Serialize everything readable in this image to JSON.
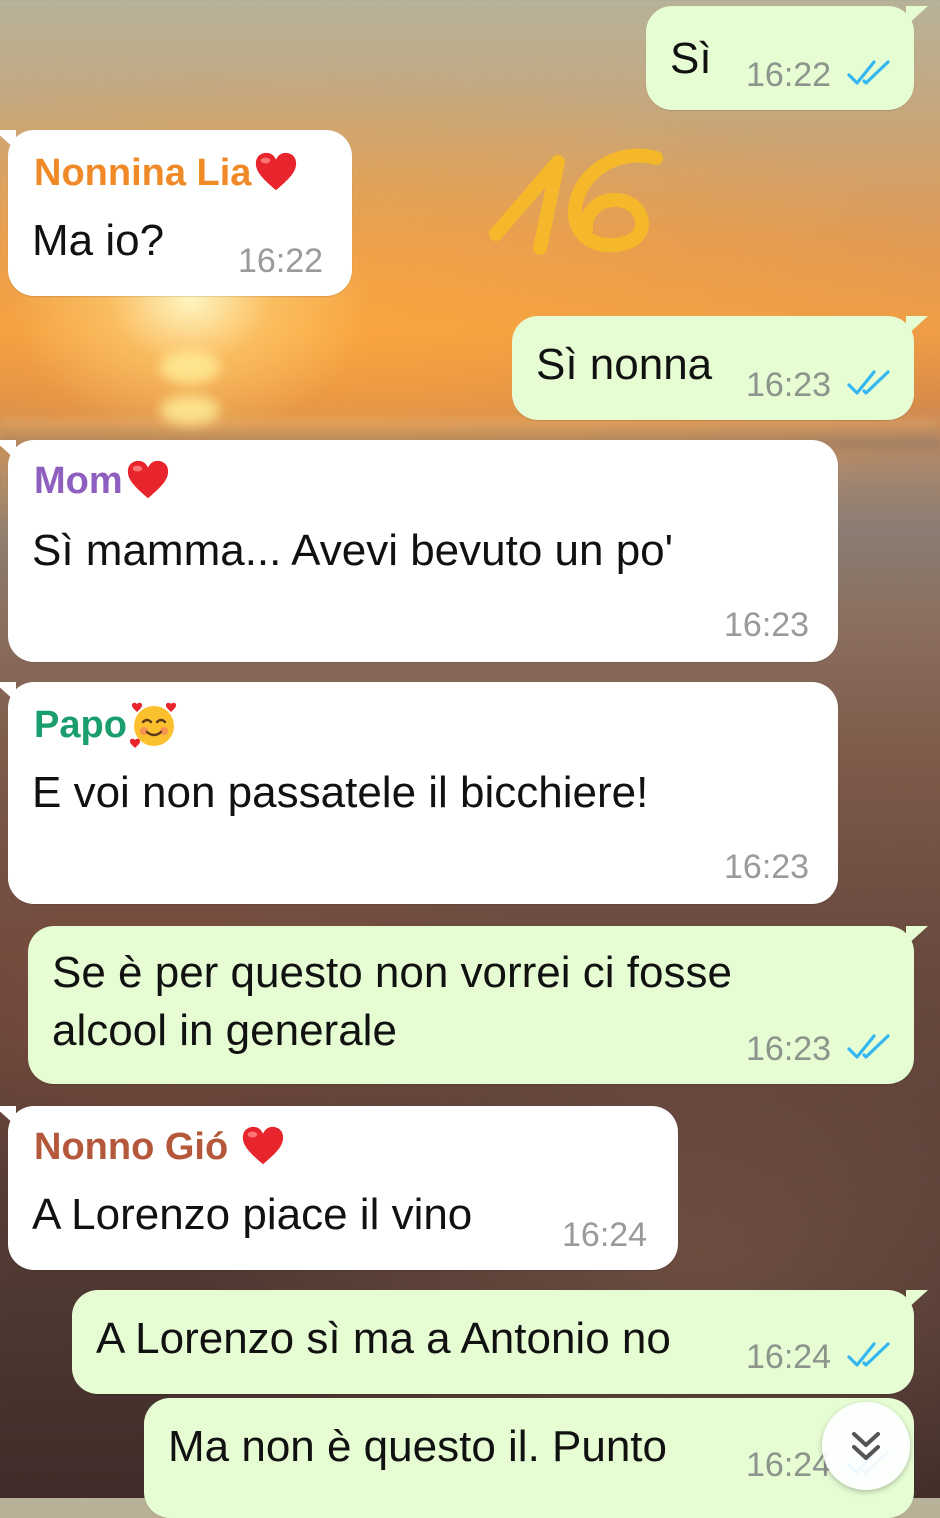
{
  "colors": {
    "outgoing_bubble": "#e6fdd4",
    "incoming_bubble": "#ffffff",
    "read_ticks": "#34b7f1",
    "sender_nonnina": "#f08a28",
    "sender_mom": "#8e5fbf",
    "sender_papo": "#1a9e6e",
    "sender_nonno": "#b5573a",
    "doodle": "#f5b82a"
  },
  "doodle_text": "16",
  "messages": [
    {
      "type": "outgoing",
      "text": "Sì",
      "time": "16:22",
      "status": "read"
    },
    {
      "type": "incoming",
      "sender": "Nonnina Lia",
      "sender_icon": "red-heart",
      "text": "Ma io?",
      "time": "16:22"
    },
    {
      "type": "outgoing",
      "text": "Sì nonna",
      "time": "16:23",
      "status": "read"
    },
    {
      "type": "incoming",
      "sender": "Mom",
      "sender_icon": "red-heart",
      "text": "Sì mamma... Avevi bevuto un po'",
      "time": "16:23"
    },
    {
      "type": "incoming",
      "sender": "Papo",
      "sender_icon": "smiling-face-with-hearts",
      "text": "E voi non passatele il bicchiere!",
      "time": "16:23"
    },
    {
      "type": "outgoing",
      "text_line1": "Se è per questo non vorrei ci fosse",
      "text_line2": "alcool in generale",
      "time": "16:23",
      "status": "read"
    },
    {
      "type": "incoming",
      "sender": "Nonno Gió",
      "sender_icon": "red-heart",
      "text": "A Lorenzo piace il vino",
      "time": "16:24"
    },
    {
      "type": "outgoing",
      "text": "A Lorenzo sì ma a Antonio no",
      "time": "16:24",
      "status": "read"
    },
    {
      "type": "outgoing",
      "text": "Ma non è questo il. Punto",
      "time": "16:24",
      "status": "read"
    }
  ],
  "scroll_button_icon": "double-chevron-down-icon"
}
